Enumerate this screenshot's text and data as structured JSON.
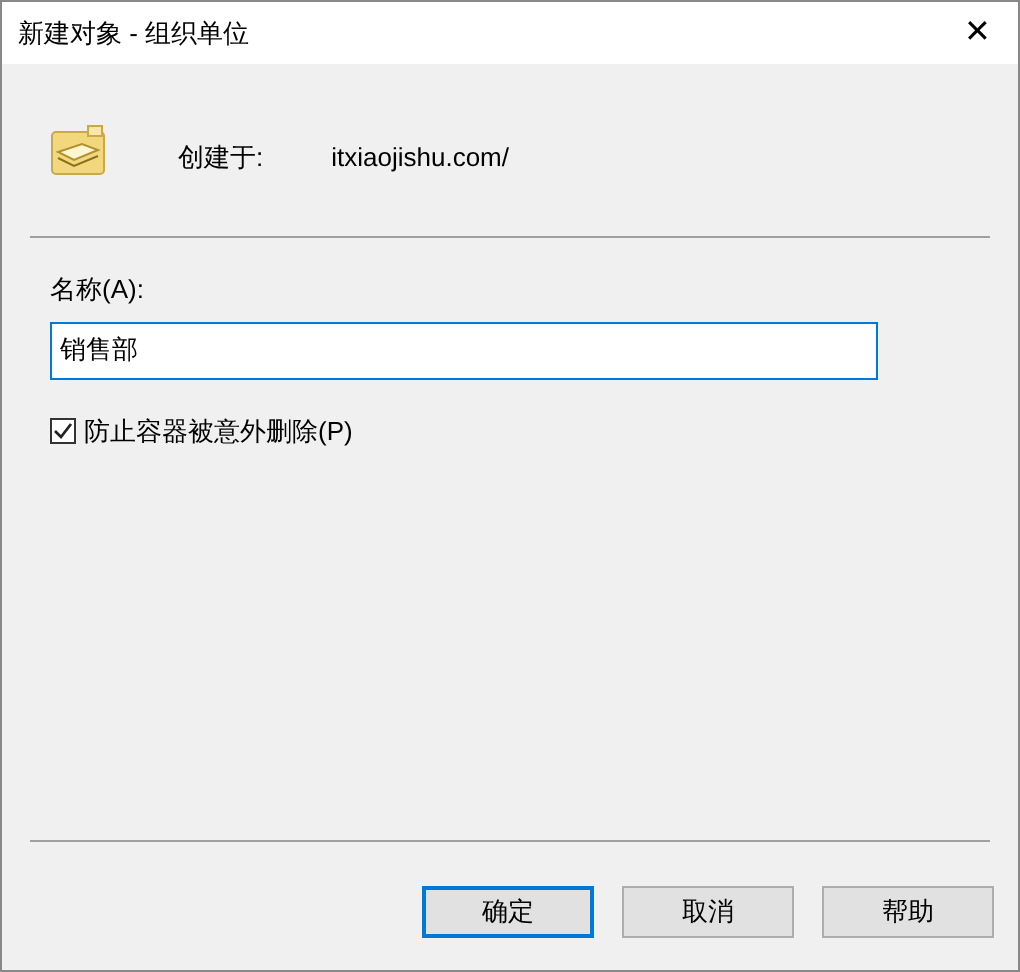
{
  "window": {
    "title": "新建对象 - 组织单位",
    "close": "✕"
  },
  "created_in": {
    "label": "创建于:",
    "value": "itxiaojishu.com/"
  },
  "name_field": {
    "label": "名称(A):",
    "value": "销售部"
  },
  "protect": {
    "label": "防止容器被意外删除(P)",
    "checked": true
  },
  "buttons": [
    {
      "label": "确定",
      "selected": true
    },
    {
      "label": "取消",
      "selected": false
    },
    {
      "label": "帮助",
      "selected": false
    }
  ]
}
